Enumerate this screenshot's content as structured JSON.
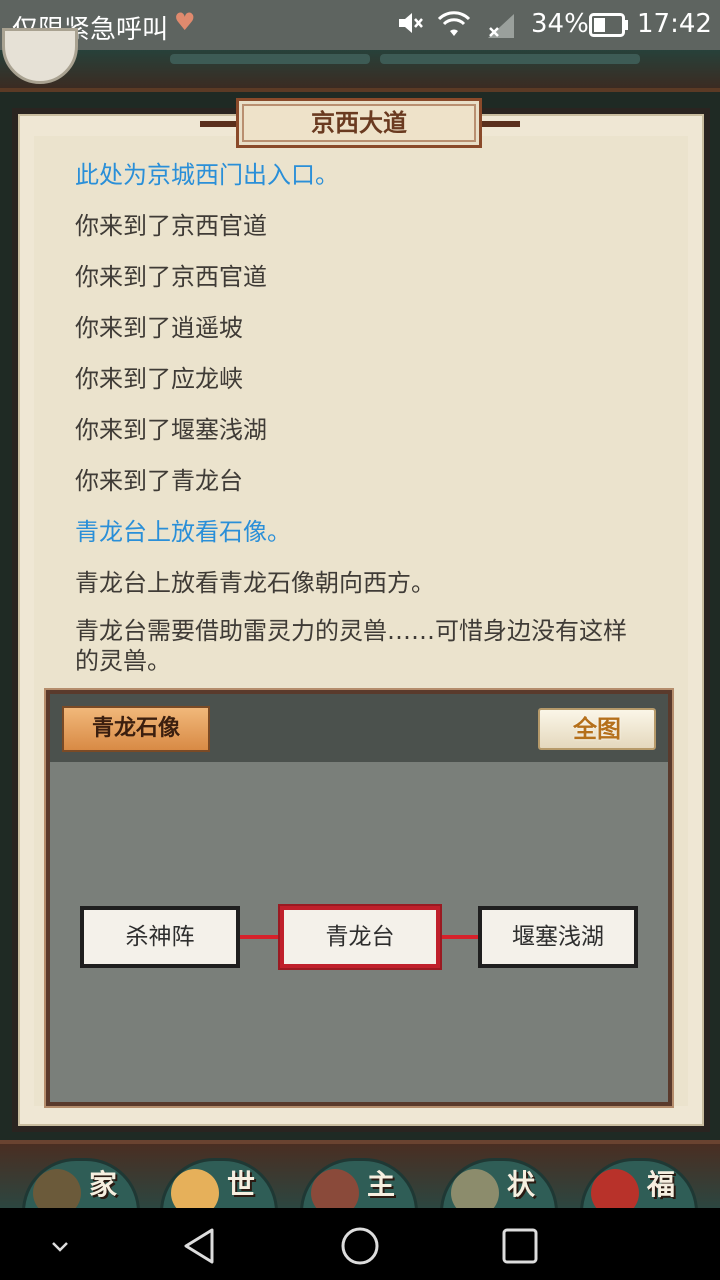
{
  "status_bar": {
    "carrier": "仅限紧急呼叫",
    "battery_percent": "34%",
    "time": "17:42",
    "icons": [
      "heart-icon",
      "mute-icon",
      "wifi-icon",
      "signal-icon",
      "battery-icon"
    ]
  },
  "location": {
    "title": "京西大道"
  },
  "log": [
    {
      "text": "此处为京城西门出入口。",
      "highlight": true
    },
    {
      "text": "你来到了京西官道",
      "highlight": false
    },
    {
      "text": "你来到了京西官道",
      "highlight": false
    },
    {
      "text": "你来到了逍遥坡",
      "highlight": false
    },
    {
      "text": "你来到了应龙峡",
      "highlight": false
    },
    {
      "text": "你来到了堰塞浅湖",
      "highlight": false
    },
    {
      "text": "你来到了青龙台",
      "highlight": false
    },
    {
      "text": "青龙台上放看石像。",
      "highlight": true
    },
    {
      "text": "青龙台上放看青龙石像朝向西方。",
      "highlight": false
    },
    {
      "text": "青龙台需要借助雷灵力的灵兽……可惜身边没有这样的灵兽。",
      "highlight": false
    }
  ],
  "map": {
    "object_title": "青龙石像",
    "full_map_button": "全图",
    "nodes": [
      {
        "label": "杀神阵",
        "current": false
      },
      {
        "label": "青龙台",
        "current": true
      },
      {
        "label": "堰塞浅湖",
        "current": false
      }
    ]
  },
  "bottom_nav": [
    {
      "label": "家",
      "icon": "home-icon"
    },
    {
      "label": "世",
      "icon": "world-icon"
    },
    {
      "label": "主",
      "icon": "character-icon"
    },
    {
      "label": "状",
      "icon": "status-icon"
    },
    {
      "label": "福",
      "icon": "fortune-icon"
    }
  ],
  "colors": {
    "highlight_text": "#2a8fd8",
    "body_text": "#3f3b36",
    "current_node_border": "#c0202c",
    "panel_bg": "#ebe3cd"
  }
}
